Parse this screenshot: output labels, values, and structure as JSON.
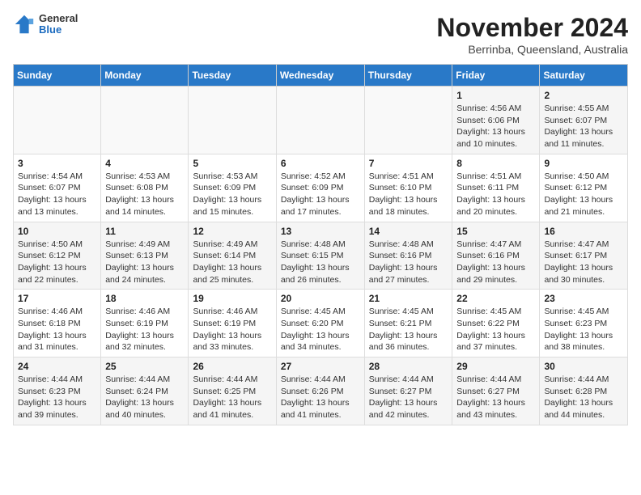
{
  "header": {
    "logo_general": "General",
    "logo_blue": "Blue",
    "month_title": "November 2024",
    "location": "Berrinba, Queensland, Australia"
  },
  "calendar": {
    "days_of_week": [
      "Sunday",
      "Monday",
      "Tuesday",
      "Wednesday",
      "Thursday",
      "Friday",
      "Saturday"
    ],
    "weeks": [
      [
        {
          "day": "",
          "info": ""
        },
        {
          "day": "",
          "info": ""
        },
        {
          "day": "",
          "info": ""
        },
        {
          "day": "",
          "info": ""
        },
        {
          "day": "",
          "info": ""
        },
        {
          "day": "1",
          "info": "Sunrise: 4:56 AM\nSunset: 6:06 PM\nDaylight: 13 hours and 10 minutes."
        },
        {
          "day": "2",
          "info": "Sunrise: 4:55 AM\nSunset: 6:07 PM\nDaylight: 13 hours and 11 minutes."
        }
      ],
      [
        {
          "day": "3",
          "info": "Sunrise: 4:54 AM\nSunset: 6:07 PM\nDaylight: 13 hours and 13 minutes."
        },
        {
          "day": "4",
          "info": "Sunrise: 4:53 AM\nSunset: 6:08 PM\nDaylight: 13 hours and 14 minutes."
        },
        {
          "day": "5",
          "info": "Sunrise: 4:53 AM\nSunset: 6:09 PM\nDaylight: 13 hours and 15 minutes."
        },
        {
          "day": "6",
          "info": "Sunrise: 4:52 AM\nSunset: 6:09 PM\nDaylight: 13 hours and 17 minutes."
        },
        {
          "day": "7",
          "info": "Sunrise: 4:51 AM\nSunset: 6:10 PM\nDaylight: 13 hours and 18 minutes."
        },
        {
          "day": "8",
          "info": "Sunrise: 4:51 AM\nSunset: 6:11 PM\nDaylight: 13 hours and 20 minutes."
        },
        {
          "day": "9",
          "info": "Sunrise: 4:50 AM\nSunset: 6:12 PM\nDaylight: 13 hours and 21 minutes."
        }
      ],
      [
        {
          "day": "10",
          "info": "Sunrise: 4:50 AM\nSunset: 6:12 PM\nDaylight: 13 hours and 22 minutes."
        },
        {
          "day": "11",
          "info": "Sunrise: 4:49 AM\nSunset: 6:13 PM\nDaylight: 13 hours and 24 minutes."
        },
        {
          "day": "12",
          "info": "Sunrise: 4:49 AM\nSunset: 6:14 PM\nDaylight: 13 hours and 25 minutes."
        },
        {
          "day": "13",
          "info": "Sunrise: 4:48 AM\nSunset: 6:15 PM\nDaylight: 13 hours and 26 minutes."
        },
        {
          "day": "14",
          "info": "Sunrise: 4:48 AM\nSunset: 6:16 PM\nDaylight: 13 hours and 27 minutes."
        },
        {
          "day": "15",
          "info": "Sunrise: 4:47 AM\nSunset: 6:16 PM\nDaylight: 13 hours and 29 minutes."
        },
        {
          "day": "16",
          "info": "Sunrise: 4:47 AM\nSunset: 6:17 PM\nDaylight: 13 hours and 30 minutes."
        }
      ],
      [
        {
          "day": "17",
          "info": "Sunrise: 4:46 AM\nSunset: 6:18 PM\nDaylight: 13 hours and 31 minutes."
        },
        {
          "day": "18",
          "info": "Sunrise: 4:46 AM\nSunset: 6:19 PM\nDaylight: 13 hours and 32 minutes."
        },
        {
          "day": "19",
          "info": "Sunrise: 4:46 AM\nSunset: 6:19 PM\nDaylight: 13 hours and 33 minutes."
        },
        {
          "day": "20",
          "info": "Sunrise: 4:45 AM\nSunset: 6:20 PM\nDaylight: 13 hours and 34 minutes."
        },
        {
          "day": "21",
          "info": "Sunrise: 4:45 AM\nSunset: 6:21 PM\nDaylight: 13 hours and 36 minutes."
        },
        {
          "day": "22",
          "info": "Sunrise: 4:45 AM\nSunset: 6:22 PM\nDaylight: 13 hours and 37 minutes."
        },
        {
          "day": "23",
          "info": "Sunrise: 4:45 AM\nSunset: 6:23 PM\nDaylight: 13 hours and 38 minutes."
        }
      ],
      [
        {
          "day": "24",
          "info": "Sunrise: 4:44 AM\nSunset: 6:23 PM\nDaylight: 13 hours and 39 minutes."
        },
        {
          "day": "25",
          "info": "Sunrise: 4:44 AM\nSunset: 6:24 PM\nDaylight: 13 hours and 40 minutes."
        },
        {
          "day": "26",
          "info": "Sunrise: 4:44 AM\nSunset: 6:25 PM\nDaylight: 13 hours and 41 minutes."
        },
        {
          "day": "27",
          "info": "Sunrise: 4:44 AM\nSunset: 6:26 PM\nDaylight: 13 hours and 41 minutes."
        },
        {
          "day": "28",
          "info": "Sunrise: 4:44 AM\nSunset: 6:27 PM\nDaylight: 13 hours and 42 minutes."
        },
        {
          "day": "29",
          "info": "Sunrise: 4:44 AM\nSunset: 6:27 PM\nDaylight: 13 hours and 43 minutes."
        },
        {
          "day": "30",
          "info": "Sunrise: 4:44 AM\nSunset: 6:28 PM\nDaylight: 13 hours and 44 minutes."
        }
      ]
    ]
  }
}
